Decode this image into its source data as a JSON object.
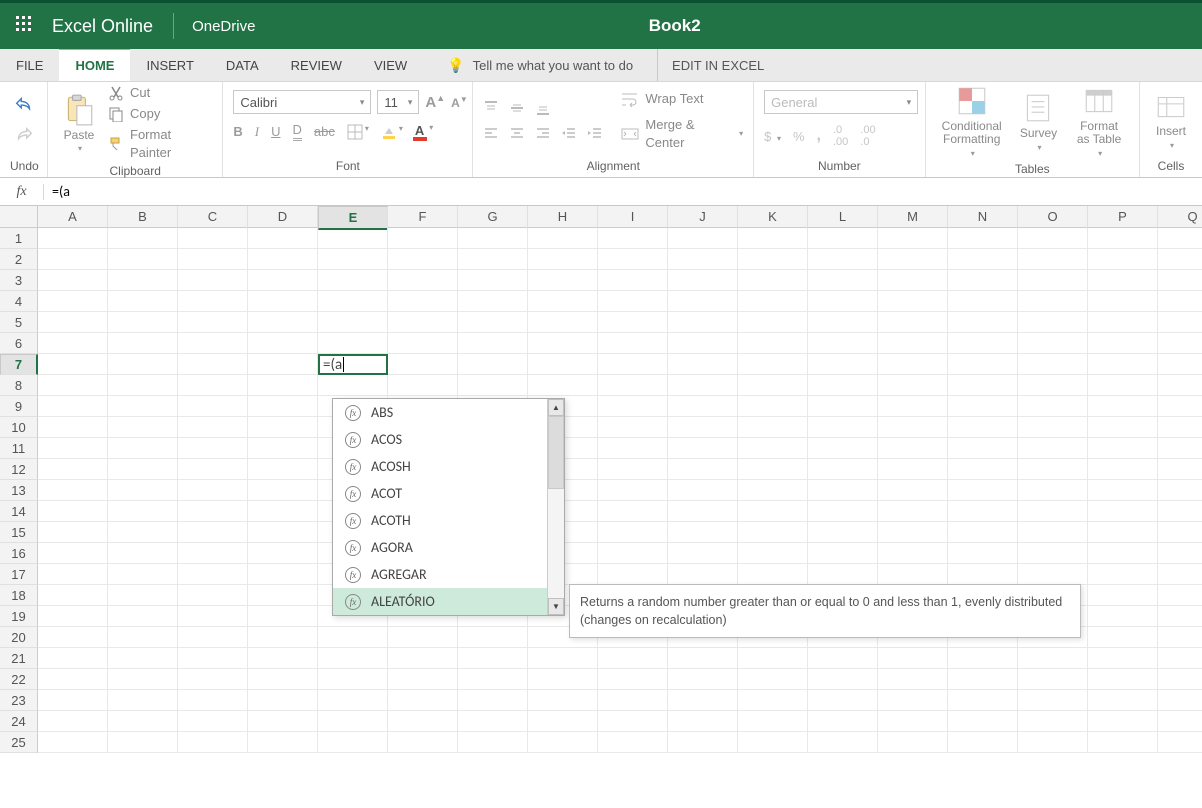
{
  "titlebar": {
    "app": "Excel Online",
    "location": "OneDrive",
    "doc": "Book2"
  },
  "tabs": {
    "file": "FILE",
    "home": "HOME",
    "insert": "INSERT",
    "data": "DATA",
    "review": "REVIEW",
    "view": "VIEW",
    "tellme": "Tell me what you want to do",
    "edit": "EDIT IN EXCEL"
  },
  "ribbon": {
    "undo": "Undo",
    "clipboard": {
      "label": "Clipboard",
      "paste": "Paste",
      "cut": "Cut",
      "copy": "Copy",
      "painter": "Format Painter"
    },
    "font": {
      "label": "Font",
      "name": "Calibri",
      "size": "11"
    },
    "alignment": {
      "label": "Alignment",
      "wrap": "Wrap Text",
      "merge": "Merge & Center"
    },
    "number": {
      "label": "Number",
      "format": "General"
    },
    "tables": {
      "label": "Tables",
      "cond1": "Conditional",
      "cond2": "Formatting",
      "survey": "Survey",
      "fmt1": "Format",
      "fmt2": "as Table"
    },
    "cells": {
      "label": "Cells",
      "insert": "Insert"
    }
  },
  "formula_bar": {
    "fx": "fx",
    "value": "=(a"
  },
  "grid": {
    "columns": [
      "A",
      "B",
      "C",
      "D",
      "E",
      "F",
      "G",
      "H",
      "I",
      "J",
      "K",
      "L",
      "M",
      "N",
      "O",
      "P",
      "Q"
    ],
    "rows": [
      "1",
      "2",
      "3",
      "4",
      "5",
      "6",
      "7",
      "8",
      "9",
      "10",
      "11",
      "12",
      "13",
      "14",
      "15",
      "16",
      "17",
      "18",
      "19",
      "20",
      "21",
      "22",
      "23",
      "24",
      "25"
    ],
    "active_col": "E",
    "active_row_index": 6,
    "cell_text": "=(a"
  },
  "autocomplete": {
    "items": [
      "ABS",
      "ACOS",
      "ACOSH",
      "ACOT",
      "ACOTH",
      "AGORA",
      "AGREGAR",
      "ALEATÓRIO"
    ],
    "highlighted_index": 7,
    "tooltip": "Returns a random number greater than or equal to 0 and less than 1, evenly distributed (changes on recalculation)"
  }
}
